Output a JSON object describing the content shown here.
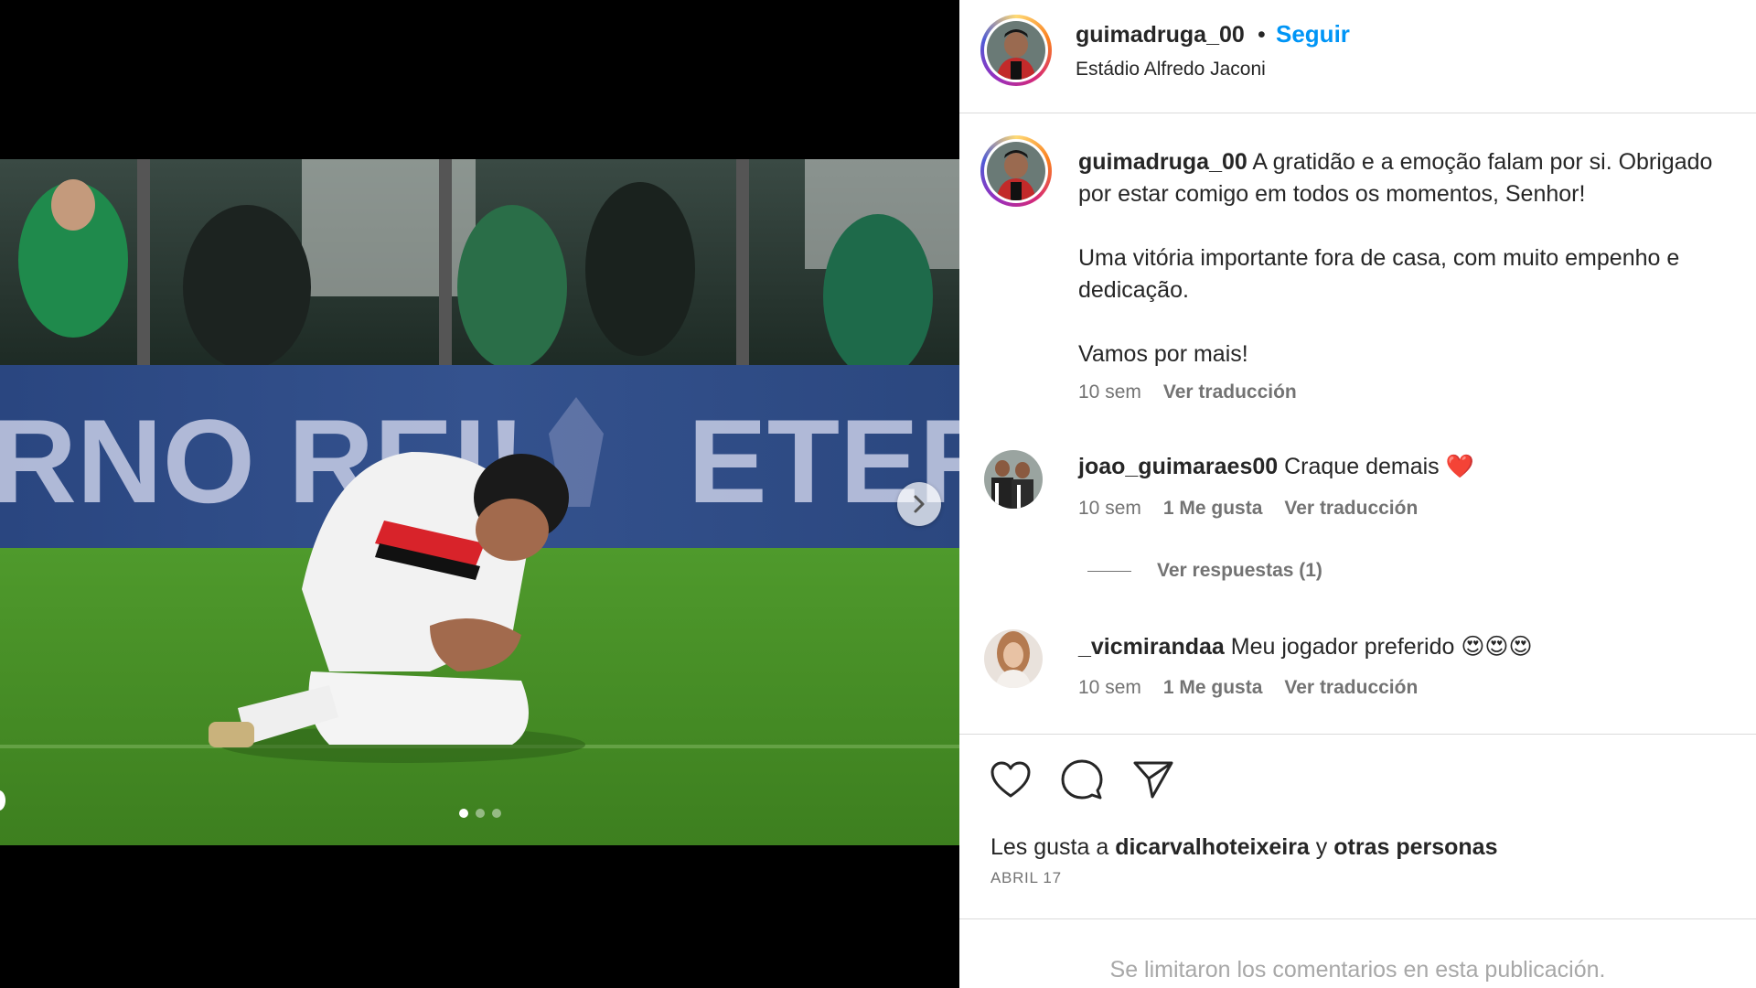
{
  "post": {
    "author": "guimadruga_00",
    "follow_label": "Seguir",
    "separator": "•",
    "location": "Estádio Alfredo Jaconi"
  },
  "media": {
    "banner_text_left": "RNO REI!",
    "banner_text_right": "ETERN",
    "dots": [
      true,
      false,
      false
    ],
    "next_icon": "chevron-right-icon"
  },
  "caption": {
    "username": "guimadruga_00",
    "line1": "A gratidão e a emoção falam por si. Obrigado",
    "line2": "por estar comigo em todos os momentos, Senhor!",
    "line3": "Uma vitória importante fora de casa, com muito empenho e",
    "line4": "dedicação.",
    "line5": "Vamos por mais!",
    "time": "10 sem",
    "translate": "Ver traducción"
  },
  "comments": [
    {
      "username": "joao_guimaraes00",
      "text": "Craque demais",
      "emoji": "❤️",
      "time": "10 sem",
      "likes": "1 Me gusta",
      "translate": "Ver traducción",
      "replies": "Ver respuestas (1)"
    },
    {
      "username": "_vicmirandaa",
      "text": "Meu jogador preferido",
      "emoji": "😍😍😍",
      "time": "10 sem",
      "likes": "1 Me gusta",
      "translate": "Ver traducción"
    }
  ],
  "actions": {
    "like_icon": "heart-icon",
    "comment_icon": "comment-icon",
    "share_icon": "send-icon"
  },
  "likes": {
    "prefix": "Les gusta a",
    "user": "dicarvalhoteixeira",
    "joiner": "y",
    "others": "otras personas"
  },
  "date": "ABRIL 17",
  "comments_limited": "Se limitaron los comentarios en esta publicación.",
  "colors": {
    "accent": "#0095f6",
    "text": "#262626",
    "secondary": "#737373",
    "divider": "#dbdbdb",
    "banner": "#2f4a86",
    "grass": "#4c9a2a"
  }
}
